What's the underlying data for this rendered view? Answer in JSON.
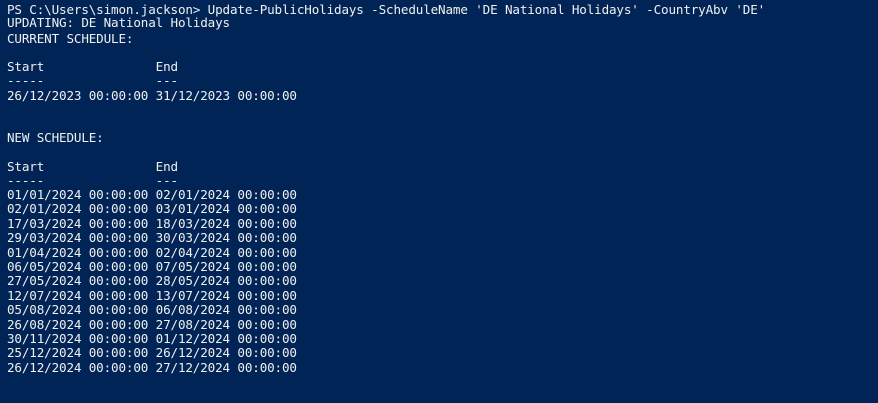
{
  "console": {
    "prompt": "PS C:\\Users\\simon.jackson>",
    "command": " Update-PublicHolidays -ScheduleName 'DE National Holidays' -CountryAbv 'DE'",
    "updating": "UPDATING: DE National Holidays",
    "current_schedule_label": "CURRENT SCHEDULE:",
    "current_header": "Start               End",
    "current_underline": "-----               ---",
    "current_rows": [
      "26/12/2023 00:00:00 31/12/2023 00:00:00"
    ],
    "new_schedule_label": "NEW SCHEDULE:",
    "new_header": "Start               End",
    "new_underline": "-----               ---",
    "new_rows": [
      "01/01/2024 00:00:00 02/01/2024 00:00:00",
      "02/01/2024 00:00:00 03/01/2024 00:00:00",
      "17/03/2024 00:00:00 18/03/2024 00:00:00",
      "29/03/2024 00:00:00 30/03/2024 00:00:00",
      "01/04/2024 00:00:00 02/04/2024 00:00:00",
      "06/05/2024 00:00:00 07/05/2024 00:00:00",
      "27/05/2024 00:00:00 28/05/2024 00:00:00",
      "12/07/2024 00:00:00 13/07/2024 00:00:00",
      "05/08/2024 00:00:00 06/08/2024 00:00:00",
      "26/08/2024 00:00:00 27/08/2024 00:00:00",
      "30/11/2024 00:00:00 01/12/2024 00:00:00",
      "25/12/2024 00:00:00 26/12/2024 00:00:00",
      "26/12/2024 00:00:00 27/12/2024 00:00:00"
    ]
  },
  "colors": {
    "background": "#012456",
    "foreground": "#f0f0f0"
  }
}
